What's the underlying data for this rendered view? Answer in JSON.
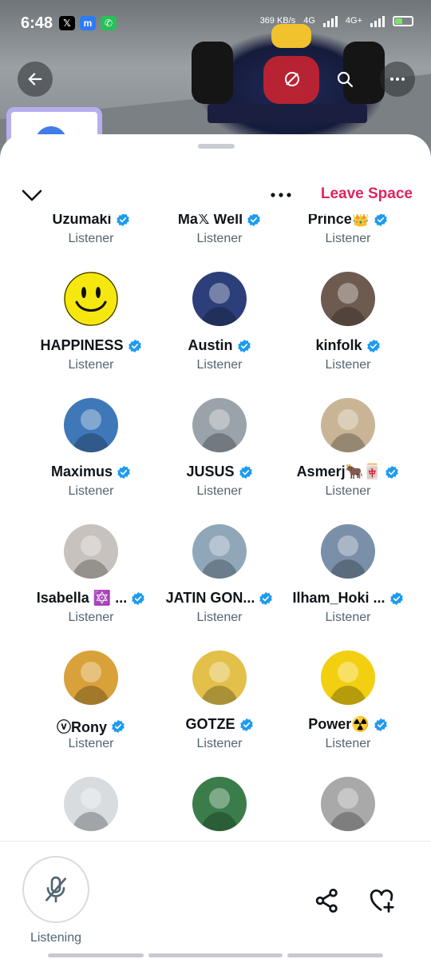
{
  "status_bar": {
    "time": "6:48",
    "speed": "369 KB/s",
    "network_1": "4G",
    "network_2": "4G+",
    "notifications": [
      "x-icon",
      "messenger-icon",
      "whatsapp-icon"
    ]
  },
  "header": {
    "back_icon": "arrow-left-icon",
    "action_icons": [
      "mute-icon",
      "search-icon",
      "more-icon"
    ]
  },
  "sheet": {
    "collapse_icon": "chevron-down-icon",
    "more_icon": "more-dots-icon",
    "leave_label": "Leave Space"
  },
  "participants": [
    {
      "name": "Uzumaki",
      "role": "Listener",
      "verified": true,
      "avatar_color": "#4a7bd0"
    },
    {
      "name": "Ma𝕏 Well",
      "role": "Listener",
      "verified": true,
      "avatar_color": "#8a6b4d"
    },
    {
      "name": "Prince👑",
      "role": "Listener",
      "verified": true,
      "avatar_color": "#5b5b5b"
    },
    {
      "name": "HAPPINESS",
      "role": "Listener",
      "verified": true,
      "avatar_color": "#f6e70f"
    },
    {
      "name": "Austin",
      "role": "Listener",
      "verified": true,
      "avatar_color": "#2d3f7a"
    },
    {
      "name": "kinfolk",
      "role": "Listener",
      "verified": true,
      "avatar_color": "#6e5b50"
    },
    {
      "name": "Maximus",
      "role": "Listener",
      "verified": true,
      "avatar_color": "#3f78b8"
    },
    {
      "name": "JUSUS",
      "role": "Listener",
      "verified": true,
      "avatar_color": "#9aa3aa"
    },
    {
      "name": "Asmerj🐂🀄",
      "role": "Listener",
      "verified": true,
      "avatar_color": "#c9b596"
    },
    {
      "name": "Isabella 🔯 ...",
      "role": "Listener",
      "verified": true,
      "avatar_color": "#c7c2bd"
    },
    {
      "name": "JATIN GON...",
      "role": "Listener",
      "verified": true,
      "avatar_color": "#8fa7b8"
    },
    {
      "name": "Ilham_Hoki ...",
      "role": "Listener",
      "verified": true,
      "avatar_color": "#7a8fa8"
    },
    {
      "name": "ⓥRony",
      "role": "Listener",
      "verified": true,
      "avatar_color": "#d9a13a"
    },
    {
      "name": "GOTZE",
      "role": "Listener",
      "verified": true,
      "avatar_color": "#e3c04a"
    },
    {
      "name": "Power☢️",
      "role": "Listener",
      "verified": true,
      "avatar_color": "#f3cf12"
    },
    {
      "name": "",
      "role": "",
      "verified": false,
      "avatar_color": "#d9dcdf"
    },
    {
      "name": "",
      "role": "",
      "verified": false,
      "avatar_color": "#3a7d4a"
    },
    {
      "name": "",
      "role": "",
      "verified": false,
      "avatar_color": "#a9a9a9"
    }
  ],
  "footer": {
    "mic_icon": "mic-off-icon",
    "listening_label": "Listening",
    "share_icon": "share-icon",
    "heart_icon": "heart-plus-icon"
  },
  "colors": {
    "accent_red": "#e0245e",
    "verified_blue": "#1d9bf0",
    "text_primary": "#0f1419",
    "text_secondary": "#536471"
  }
}
